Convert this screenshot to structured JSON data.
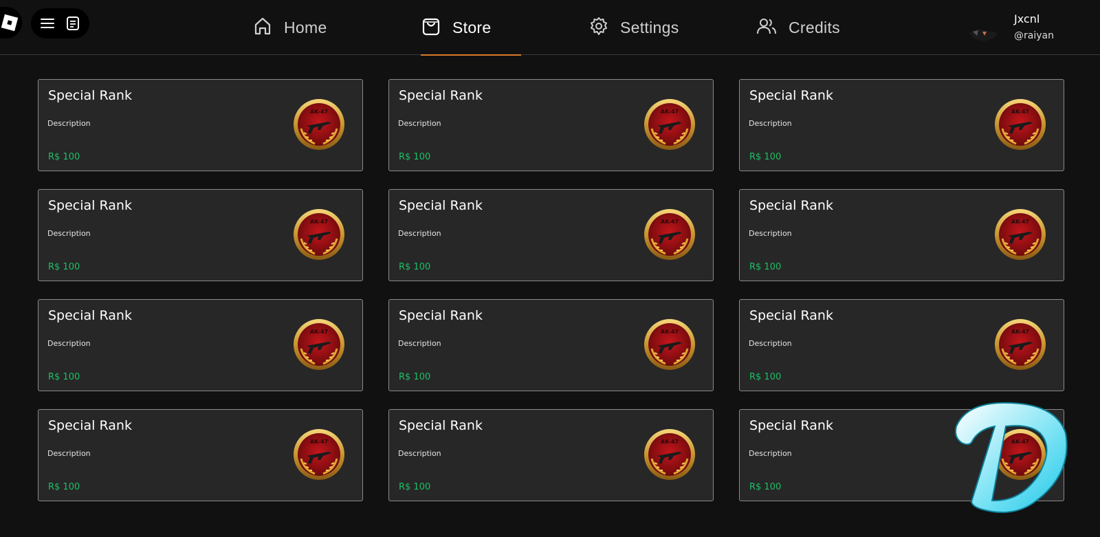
{
  "header": {
    "nav": [
      {
        "label": "Home",
        "icon": "home-icon",
        "active": false
      },
      {
        "label": "Store",
        "icon": "shopping-bag-icon",
        "active": true
      },
      {
        "label": "Settings",
        "icon": "gear-icon",
        "active": false
      },
      {
        "label": "Credits",
        "icon": "users-icon",
        "active": false
      }
    ],
    "profile": {
      "name": "Jxcnl",
      "handle": "@raiyan"
    },
    "accent_color": "#d87a2a"
  },
  "store": {
    "price_color": "#1fbf66",
    "items": [
      {
        "title": "Special Rank",
        "description": "Description",
        "price": "R$ 100",
        "badge_text": "AK-47"
      },
      {
        "title": "Special Rank",
        "description": "Description",
        "price": "R$ 100",
        "badge_text": "AK-47"
      },
      {
        "title": "Special Rank",
        "description": "Description",
        "price": "R$ 100",
        "badge_text": "AK-47"
      },
      {
        "title": "Special Rank",
        "description": "Description",
        "price": "R$ 100",
        "badge_text": "AK-47"
      },
      {
        "title": "Special Rank",
        "description": "Description",
        "price": "R$ 100",
        "badge_text": "AK-47"
      },
      {
        "title": "Special Rank",
        "description": "Description",
        "price": "R$ 100",
        "badge_text": "AK-47"
      },
      {
        "title": "Special Rank",
        "description": "Description",
        "price": "R$ 100",
        "badge_text": "AK-47"
      },
      {
        "title": "Special Rank",
        "description": "Description",
        "price": "R$ 100",
        "badge_text": "AK-47"
      },
      {
        "title": "Special Rank",
        "description": "Description",
        "price": "R$ 100",
        "badge_text": "AK-47"
      },
      {
        "title": "Special Rank",
        "description": "Description",
        "price": "R$ 100",
        "badge_text": "AK-47"
      },
      {
        "title": "Special Rank",
        "description": "Description",
        "price": "R$ 100",
        "badge_text": "AK-47"
      },
      {
        "title": "Special Rank",
        "description": "Description",
        "price": "R$ 100",
        "badge_text": "AK-47"
      }
    ]
  },
  "watermark": {
    "letter": "D"
  }
}
